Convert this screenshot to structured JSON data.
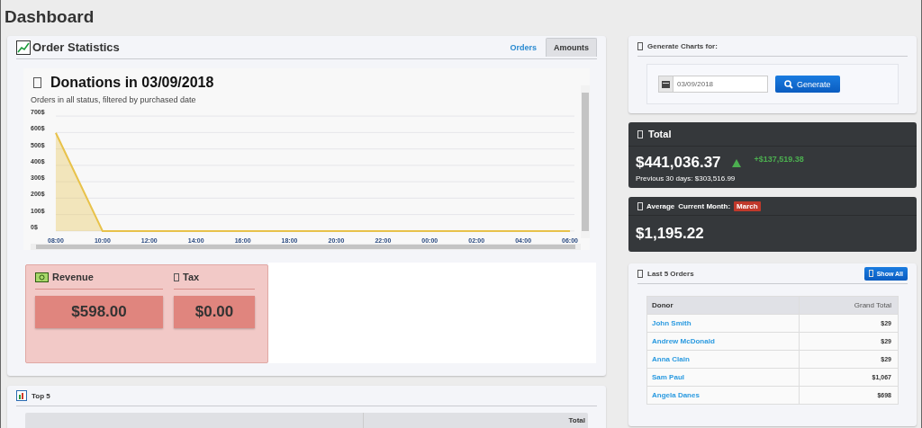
{
  "page_title": "Dashboard",
  "order_statistics": {
    "title": "Order Statistics",
    "tabs": [
      {
        "label": "Orders",
        "selected": false
      },
      {
        "label": "Amounts",
        "selected": true
      }
    ],
    "chart_heading": "Donations in 03/09/2018",
    "chart_subtitle": "Orders in all status, filtered by purchased date",
    "chart_data": {
      "type": "area",
      "grid": true,
      "categories": [
        "08:00",
        "10:00",
        "12:00",
        "14:00",
        "16:00",
        "18:00",
        "20:00",
        "22:00",
        "00:00",
        "02:00",
        "04:00",
        "06:00"
      ],
      "series": [
        {
          "color": "#e8c24a",
          "values": [
            598,
            0,
            0,
            0,
            0,
            0,
            0,
            0,
            0,
            0,
            0,
            0
          ]
        }
      ],
      "ylim": [
        0,
        700
      ],
      "yticks": [
        {
          "value": 0,
          "label": "0$"
        },
        {
          "value": 100,
          "label": "100$"
        },
        {
          "value": 200,
          "label": "200$"
        },
        {
          "value": 300,
          "label": "300$"
        },
        {
          "value": 400,
          "label": "400$"
        },
        {
          "value": 500,
          "label": "500$"
        },
        {
          "value": 600,
          "label": "600$"
        },
        {
          "value": 700,
          "label": "700$"
        }
      ]
    },
    "stats": [
      {
        "label": "Revenue",
        "value": "$598.00",
        "kind": "money"
      },
      {
        "label": "Tax",
        "value": "$0.00",
        "kind": "blank"
      }
    ]
  },
  "top5": {
    "title": "Top 5",
    "column_2": "Total"
  },
  "generate": {
    "title": "Generate Charts for:",
    "date": "03/09/2018",
    "button": "Generate"
  },
  "total": {
    "title": "Total",
    "amount": "$441,036.37",
    "change": "+$137,519.38",
    "previous": "Previous 30 days: $303,516.99"
  },
  "average": {
    "title_1": "Average",
    "title_2": "Current Month:",
    "badge": "March",
    "amount": "$1,195.22"
  },
  "last_orders": {
    "title": "Last 5 Orders",
    "button": "Show All",
    "columns": [
      "Donor",
      "Grand Total"
    ],
    "rows": [
      {
        "donor": "John Smith",
        "total": "$29"
      },
      {
        "donor": "Andrew McDonald",
        "total": "$29"
      },
      {
        "donor": "Anna Clain",
        "total": "$29"
      },
      {
        "donor": "Sam Paul",
        "total": "$1,067"
      },
      {
        "donor": "Angela Danes",
        "total": "$698"
      }
    ]
  }
}
